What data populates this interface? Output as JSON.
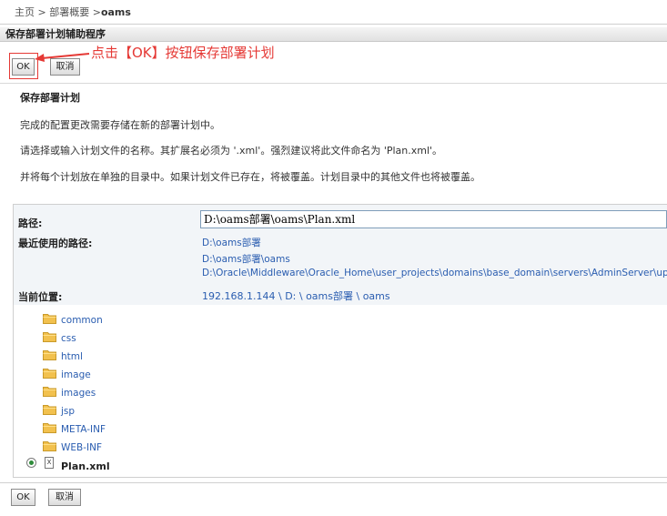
{
  "breadcrumb": {
    "home": "主页",
    "sep1": " >",
    "overview": "部署概要",
    "sep2": " >",
    "current": "oams"
  },
  "window": {
    "title": "保存部署计划辅助程序"
  },
  "toolbar": {
    "ok_label": "OK",
    "cancel_label": "取消"
  },
  "annotation": {
    "text": "点击【OK】按钮保存部署计划",
    "color": "#e53935"
  },
  "section": {
    "title": "保存部署计划",
    "line1": "完成的配置更改需要存储在新的部署计划中。",
    "line2": "请选择或输入计划文件的名称。其扩展名必须为 '.xml'。强烈建议将此文件命名为 'Plan.xml'。",
    "line3": "并将每个计划放在单独的目录中。如果计划文件已存在，将被覆盖。计划目录中的其他文件也将被覆盖。"
  },
  "form": {
    "path_label": "路径:",
    "path_value": "D:\\oams部署\\oams\\Plan.xml",
    "recent_label": "最近使用的路径:",
    "recent_paths": [
      "D:\\oams部署",
      "D:\\oams部署\\oams",
      "D:\\Oracle\\Middleware\\Oracle_Home\\user_projects\\domains\\base_domain\\servers\\AdminServer\\upload"
    ],
    "location_label": "当前位置:",
    "location_parts": {
      "host": "192.168.1.144",
      "sep1": " \\ ",
      "drive": "D:",
      "sep2": " \\ ",
      "dir1": "oams部署",
      "sep3": " \\ ",
      "dir2": "oams"
    }
  },
  "files": {
    "folders": [
      "common",
      "css",
      "html",
      "image",
      "images",
      "jsp",
      "META-INF",
      "WEB-INF"
    ],
    "selected_file": "Plan.xml",
    "file_icon_letter": "X"
  },
  "colors": {
    "link": "#2a5db0",
    "folder": "#f2c14e",
    "highlight": "#e53935"
  }
}
